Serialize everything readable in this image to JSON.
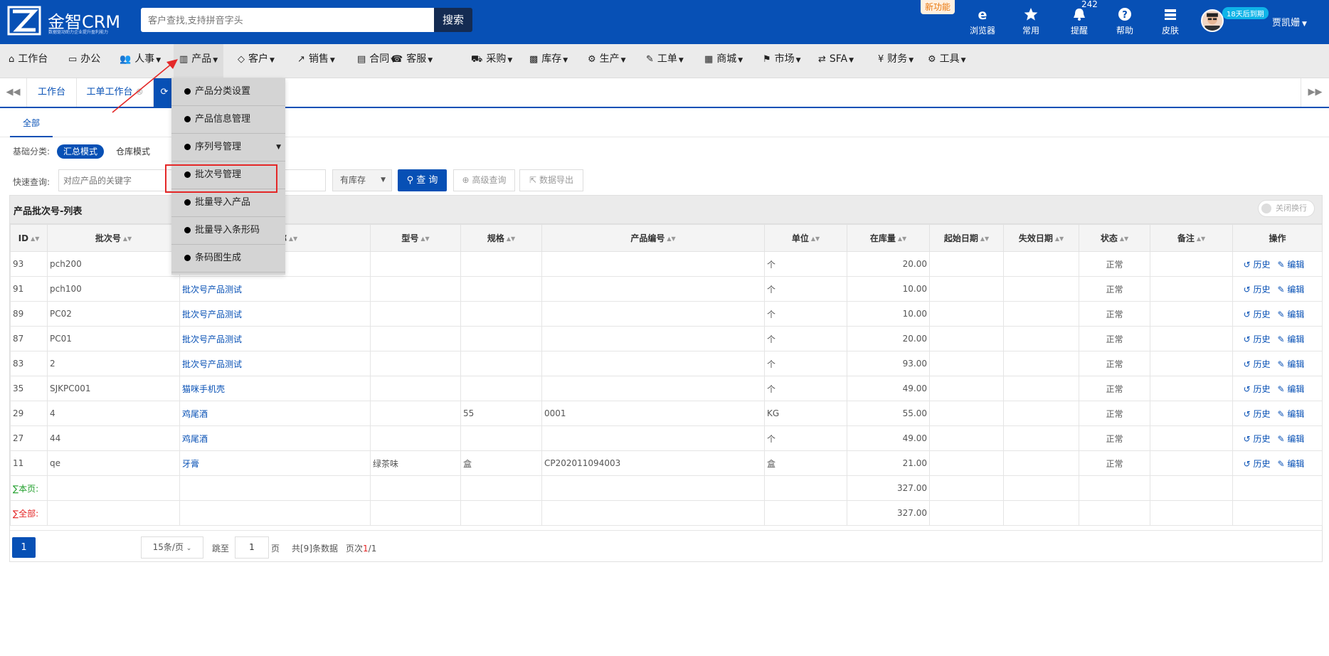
{
  "brand": {
    "name": "金智CRM",
    "slogan": "数据驱动助力企业提升盈利能力"
  },
  "search": {
    "placeholder": "客户查找,支持拼音字头",
    "button": "搜索"
  },
  "top": {
    "new_feature": "新功能",
    "notify_count": "242",
    "trial": "18天后到期",
    "username": "贾凯姗",
    "icons": [
      {
        "label": "浏览器",
        "icon": "ie-icon"
      },
      {
        "label": "常用",
        "icon": "star-icon"
      },
      {
        "label": "提醒",
        "icon": "bell-icon"
      },
      {
        "label": "帮助",
        "icon": "help-icon"
      },
      {
        "label": "皮肤",
        "icon": "skin-icon"
      }
    ]
  },
  "menu": [
    {
      "label": "工作台",
      "icon": "home-icon",
      "glyph": "⌂",
      "caret": false
    },
    {
      "label": "办公",
      "icon": "laptop-icon",
      "glyph": "▭",
      "caret": false
    },
    {
      "label": "人事",
      "icon": "users-icon",
      "glyph": "👥",
      "caret": true
    },
    {
      "label": "产品",
      "icon": "barcode-icon",
      "glyph": "▥",
      "caret": true
    },
    {
      "label": "客户",
      "icon": "diamond-icon",
      "glyph": "◇",
      "caret": true
    },
    {
      "label": "销售",
      "icon": "chart-icon",
      "glyph": "↗",
      "caret": true
    },
    {
      "label": "合同",
      "icon": "contract-icon",
      "glyph": "▤",
      "caret": true
    },
    {
      "label": "客服",
      "icon": "phone-icon",
      "glyph": "☎",
      "caret": true
    },
    {
      "label": "采购",
      "icon": "cart-icon",
      "glyph": "⛟",
      "caret": true
    },
    {
      "label": "库存",
      "icon": "cubes-icon",
      "glyph": "▩",
      "caret": true
    },
    {
      "label": "生产",
      "icon": "cogs-icon",
      "glyph": "⚙",
      "caret": true
    },
    {
      "label": "工单",
      "icon": "wrench-icon",
      "glyph": "✎",
      "caret": true
    },
    {
      "label": "商城",
      "icon": "shop-icon",
      "glyph": "▦",
      "caret": true
    },
    {
      "label": "市场",
      "icon": "bookmark-icon",
      "glyph": "⚑",
      "caret": true
    },
    {
      "label": "SFA",
      "icon": "retweet-icon",
      "glyph": "⇄",
      "caret": true
    },
    {
      "label": "财务",
      "icon": "yen-icon",
      "glyph": "¥",
      "caret": true
    },
    {
      "label": "工具",
      "icon": "gear-icon",
      "glyph": "⚙",
      "caret": true
    }
  ],
  "tabs": {
    "workbench": "工作台",
    "ticket": "工单工作台"
  },
  "subtabs": {
    "all": "全部"
  },
  "filter": {
    "category_label": "基础分类:",
    "mode_summary": "汇总模式",
    "mode_warehouse": "仓库模式",
    "quick_label": "快速查询:",
    "keyword_placeholder": "对应产品的关键字",
    "stock_option": "有库存",
    "query": "查 询",
    "advanced": "高级查询",
    "export": "数据导出"
  },
  "panel": {
    "title": "产品批次号-列表",
    "wrap_toggle": "关闭换行"
  },
  "table": {
    "columns": [
      "ID",
      "批次号",
      "产品名称",
      "型号",
      "规格",
      "产品编号",
      "单位",
      "在库量",
      "起始日期",
      "失效日期",
      "状态",
      "备注",
      "操作"
    ],
    "rows": [
      {
        "id": "93",
        "batch": "pch200",
        "product": "",
        "model": "",
        "spec": "",
        "code": "",
        "unit": "个",
        "qty": "20.00",
        "start": "",
        "end": "",
        "status": "正常",
        "note": ""
      },
      {
        "id": "91",
        "batch": "pch100",
        "product": "批次号产品测试",
        "model": "",
        "spec": "",
        "code": "",
        "unit": "个",
        "qty": "10.00",
        "start": "",
        "end": "",
        "status": "正常",
        "note": ""
      },
      {
        "id": "89",
        "batch": "PC02",
        "product": "批次号产品测试",
        "model": "",
        "spec": "",
        "code": "",
        "unit": "个",
        "qty": "10.00",
        "start": "",
        "end": "",
        "status": "正常",
        "note": ""
      },
      {
        "id": "87",
        "batch": "PC01",
        "product": "批次号产品测试",
        "model": "",
        "spec": "",
        "code": "",
        "unit": "个",
        "qty": "20.00",
        "start": "",
        "end": "",
        "status": "正常",
        "note": ""
      },
      {
        "id": "83",
        "batch": "2",
        "product": "批次号产品测试",
        "model": "",
        "spec": "",
        "code": "",
        "unit": "个",
        "qty": "93.00",
        "start": "",
        "end": "",
        "status": "正常",
        "note": ""
      },
      {
        "id": "35",
        "batch": "SJKPC001",
        "product": "猫咪手机壳",
        "model": "",
        "spec": "",
        "code": "",
        "unit": "个",
        "qty": "49.00",
        "start": "",
        "end": "",
        "status": "正常",
        "note": ""
      },
      {
        "id": "29",
        "batch": "4",
        "product": "鸡尾酒",
        "model": "",
        "spec": "55",
        "code": "0001",
        "unit": "KG",
        "qty": "55.00",
        "start": "",
        "end": "",
        "status": "正常",
        "note": ""
      },
      {
        "id": "27",
        "batch": "44",
        "product": "鸡尾酒",
        "model": "",
        "spec": "",
        "code": "",
        "unit": "个",
        "qty": "49.00",
        "start": "",
        "end": "",
        "status": "正常",
        "note": ""
      },
      {
        "id": "11",
        "batch": "qe",
        "product": "牙膏",
        "model": "绿茶味",
        "spec": "盒",
        "code": "CP202011094003",
        "unit": "盒",
        "qty": "21.00",
        "start": "",
        "end": "",
        "status": "正常",
        "note": ""
      }
    ],
    "ops": {
      "history": "历史",
      "edit": "编辑"
    },
    "sum_page_label": "∑本页:",
    "sum_page_qty": "327.00",
    "sum_all_label": "∑全部:",
    "sum_all_qty": "327.00"
  },
  "pager": {
    "current": "1",
    "page_size": "15条/页",
    "jump_label": "跳至",
    "jump_value": "1",
    "page_unit": "页",
    "total": "共[9]条数据",
    "pages_prefix": "页次",
    "pages_current": "1",
    "pages_total": "/1"
  },
  "dropdown": [
    {
      "label": "产品分类设置",
      "submenu": false
    },
    {
      "label": "产品信息管理",
      "submenu": false
    },
    {
      "label": "序列号管理",
      "submenu": true
    },
    {
      "label": "批次号管理",
      "submenu": false
    },
    {
      "label": "批量导入产品",
      "submenu": false
    },
    {
      "label": "批量导入条形码",
      "submenu": false
    },
    {
      "label": "条码图生成",
      "submenu": false
    }
  ],
  "colors": {
    "primary": "#0750b5",
    "highlight": "#e42828",
    "sum_page": "#1f9e2a",
    "sum_all": "#e42222"
  }
}
